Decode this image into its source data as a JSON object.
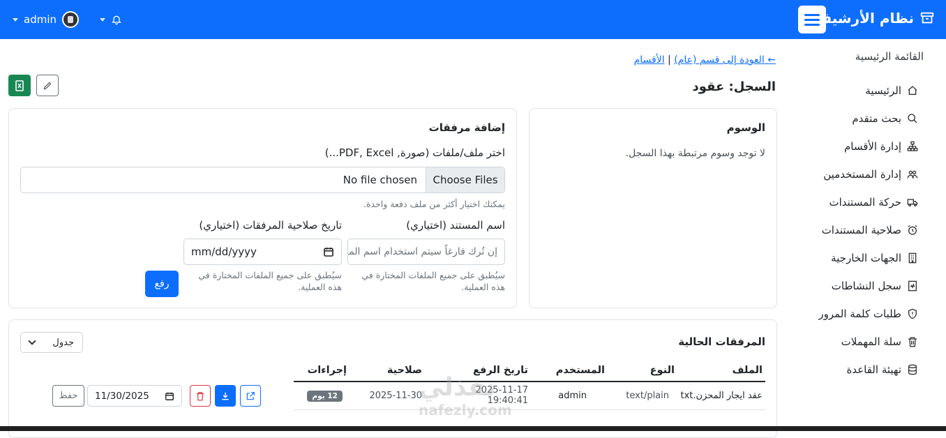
{
  "navbar": {
    "brand": "نظام الأرشيف",
    "username": "admin",
    "colors": {
      "primary": "#0d6efd"
    }
  },
  "sidebar": {
    "title": "القائمة الرئيسية",
    "items": [
      {
        "label": "الرئيسية",
        "icon": "home-icon"
      },
      {
        "label": "بحث متقدم",
        "icon": "search-icon"
      },
      {
        "label": "إدارة الأقسام",
        "icon": "sitemap-icon"
      },
      {
        "label": "إدارة المستخدمين",
        "icon": "users-icon"
      },
      {
        "label": "حركة المستندات",
        "icon": "truck-icon"
      },
      {
        "label": "صلاحية المستندات",
        "icon": "alarm-icon"
      },
      {
        "label": "الجهات الخارجية",
        "icon": "building-icon"
      },
      {
        "label": "سجل النشاطات",
        "icon": "activity-log-icon"
      },
      {
        "label": "طلبات كلمة المرور",
        "icon": "shield-icon"
      },
      {
        "label": "سلة المهملات",
        "icon": "trash-icon"
      },
      {
        "label": "تهيئة القاعدة",
        "icon": "database-icon"
      }
    ]
  },
  "breadcrumb": {
    "back": "← العودة إلى قسم (عام)",
    "separator": "|",
    "sections": "الأقسام"
  },
  "page": {
    "title": "السجل: عقود"
  },
  "tags": {
    "title": "الوسوم",
    "empty": "لا توجد وسوم مرتبطة بهذا السجل."
  },
  "upload": {
    "title": "إضافة مرفقات",
    "file_label": "اختر ملف/ملفات (صورة, PDF, Excel...)",
    "choose_button": "Choose Files",
    "file_status": "No file chosen",
    "multi_hint": "يمكنك اختيار أكثر من ملف دفعة واحدة.",
    "doc_name_label": "اسم المستند (اختياري)",
    "doc_name_placeholder": "إن تُرك فارغاً سيتم استخدام اسم الملف",
    "doc_name_hint": "سيُطبق على جميع الملفات المختارة في هذه العملية.",
    "expiry_label": "تاريخ صلاحية المرفقات (اختياري)",
    "expiry_placeholder": "mm/dd/yyyy",
    "expiry_hint": "سيُطبق على جميع الملفات المختارة في هذه العملية.",
    "upload_button": "رفع"
  },
  "attachments": {
    "title": "المرفقات الحالية",
    "view_select": "جدول",
    "columns": [
      "الملف",
      "النوع",
      "المستخدم",
      "تاريخ الرفع",
      "صلاحية",
      "إجراءات"
    ],
    "rows": [
      {
        "file": "عقد ايجار المحزن.txt",
        "type": "text/plain",
        "user": "admin",
        "uploaded": "2025-11-17 19:40:41",
        "expiry": "2025-11-30",
        "badge": "12 يوم",
        "expiry_input": "11/30/2025",
        "save_label": "حفظ"
      }
    ]
  },
  "watermark": {
    "main": "نفذلي",
    "sub": "nafezly.com"
  }
}
